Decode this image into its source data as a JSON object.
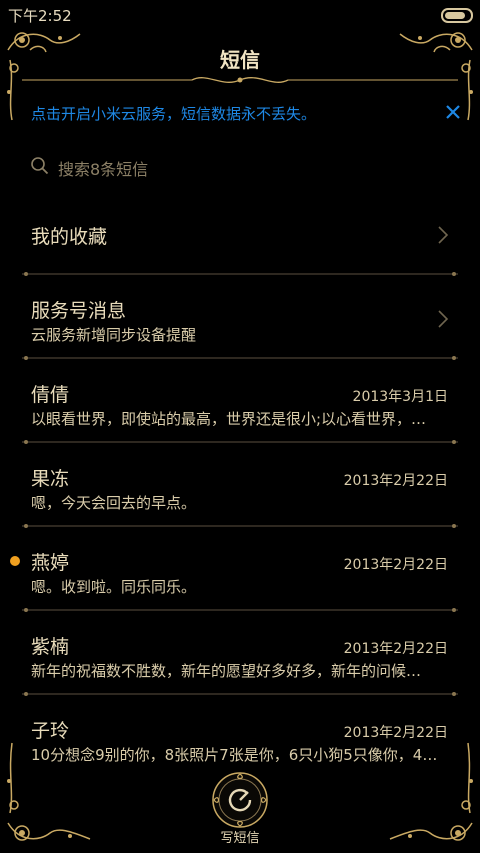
{
  "status_bar": {
    "time": "下午2:52",
    "battery_level": 1.0
  },
  "header": {
    "title": "短信"
  },
  "banner": {
    "text": "点击开启小米云服务，短信数据永不丢失。"
  },
  "search": {
    "placeholder": "搜索8条短信"
  },
  "favorites": {
    "label": "我的收藏"
  },
  "service": {
    "title": "服务号消息",
    "subtitle": "云服务新增同步设备提醒"
  },
  "conversations": [
    {
      "name": "倩倩",
      "date": "2013年3月1日",
      "snippet": "以眼看世界，即使站的最高，世界还是很小;以心看世界，…",
      "unread": false
    },
    {
      "name": "果冻",
      "date": "2013年2月22日",
      "snippet": "嗯，今天会回去的早点。",
      "unread": false
    },
    {
      "name": "燕婷",
      "date": "2013年2月22日",
      "snippet": "嗯。收到啦。同乐同乐。",
      "unread": true
    },
    {
      "name": "紫楠",
      "date": "2013年2月22日",
      "snippet": "新年的祝福数不胜数，新年的愿望好多好多，新年的问候…",
      "unread": false
    },
    {
      "name": "子玲",
      "date": "2013年2月22日",
      "snippet": "10分想念9别的你，8张照片7张是你，6只小狗5只像你，4…",
      "unread": false
    }
  ],
  "compose": {
    "label": "写短信"
  },
  "colors": {
    "background": "#000000",
    "gold": "#c9a963",
    "link_blue": "#1e88e5",
    "unread_dot": "#f0a020"
  }
}
